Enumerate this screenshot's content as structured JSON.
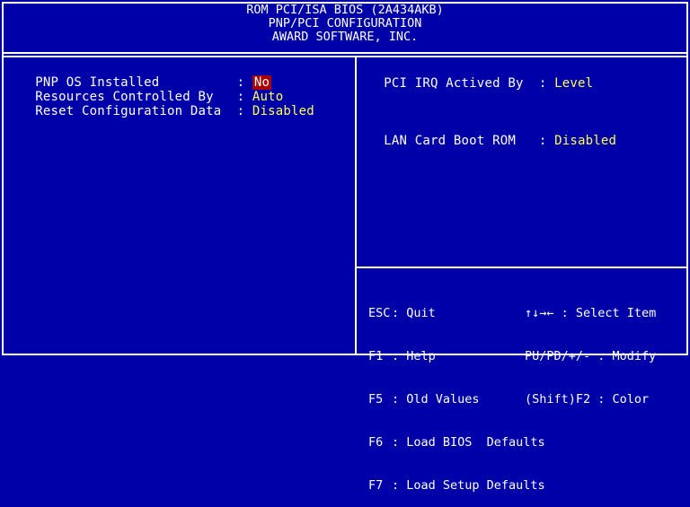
{
  "header": {
    "line1": "ROM PCI/ISA BIOS (2A434AKB)",
    "line2": "PNP/PCI CONFIGURATION",
    "line3": "AWARD SOFTWARE, INC."
  },
  "left_settings": [
    {
      "label": "PNP OS Installed          : ",
      "value": "No"
    },
    {
      "label": "Resources Controlled By   : ",
      "value": "Auto"
    },
    {
      "label": "Reset Configuration Data  : ",
      "value": "Disabled"
    }
  ],
  "right_settings": [
    {
      "label": "PCI IRQ Actived By  : ",
      "value": "Level"
    },
    {
      "label": "LAN Card Boot ROM   : ",
      "value": "Disabled"
    }
  ],
  "help": [
    {
      "key": "ESC",
      "desc": ": Quit",
      "key2": "↑↓→← : Select Item"
    },
    {
      "key": "F1",
      "desc": ": Help",
      "key2": "PU/PD/+/- : Modify"
    },
    {
      "key": "F5",
      "desc": ": Old Values",
      "key2": "(Shift)F2 : Color"
    },
    {
      "key": "F6",
      "desc": ": Load BIOS  Defaults",
      "key2": ""
    },
    {
      "key": "F7",
      "desc": ": Load Setup Defaults",
      "key2": ""
    }
  ],
  "colors": {
    "background": "#0000a8",
    "value": "#ffff55",
    "highlight": "#a80000"
  }
}
